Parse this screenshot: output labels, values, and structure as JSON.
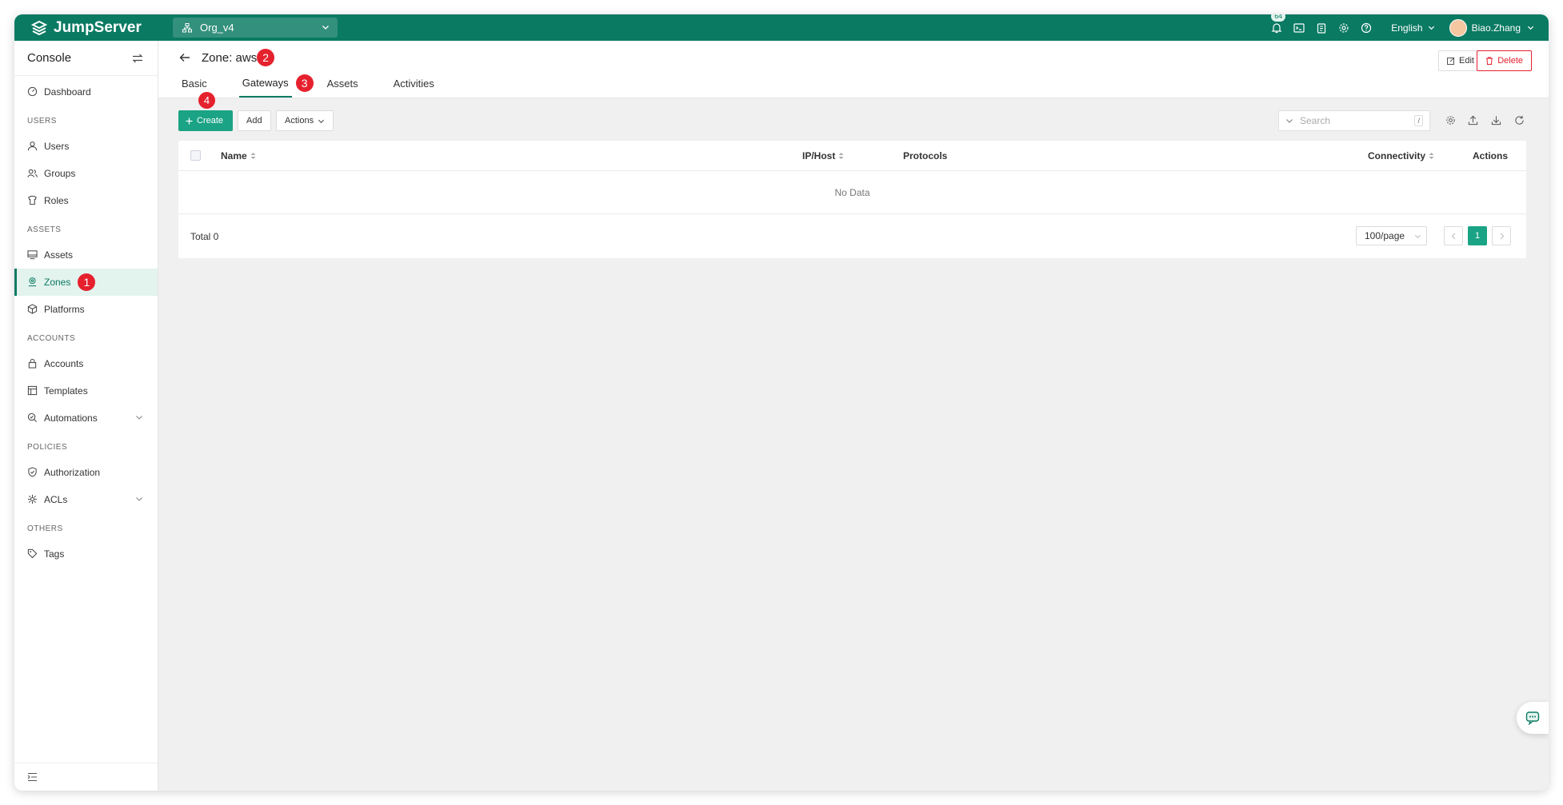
{
  "app": {
    "logo_text": "JumpServer"
  },
  "topbar": {
    "org": "Org_v4",
    "notification_count": "64",
    "language": "English",
    "username": "Biao.Zhang"
  },
  "sidebar": {
    "header": "Console",
    "sections": [
      {
        "items": [
          {
            "label": "Dashboard",
            "icon": "dashboard-icon"
          }
        ]
      },
      {
        "title": "USERS",
        "items": [
          {
            "label": "Users",
            "icon": "user-icon"
          },
          {
            "label": "Groups",
            "icon": "group-icon"
          },
          {
            "label": "Roles",
            "icon": "role-icon"
          }
        ]
      },
      {
        "title": "ASSETS",
        "items": [
          {
            "label": "Assets",
            "icon": "monitor-icon"
          },
          {
            "label": "Zones",
            "icon": "zone-icon",
            "active": true,
            "marker": "1"
          },
          {
            "label": "Platforms",
            "icon": "cube-icon"
          }
        ]
      },
      {
        "title": "ACCOUNTS",
        "items": [
          {
            "label": "Accounts",
            "icon": "lock-icon"
          },
          {
            "label": "Templates",
            "icon": "template-icon"
          },
          {
            "label": "Automations",
            "icon": "automation-icon",
            "expandable": true
          }
        ]
      },
      {
        "title": "POLICIES",
        "items": [
          {
            "label": "Authorization",
            "icon": "shield-icon"
          },
          {
            "label": "ACLs",
            "icon": "acl-icon",
            "expandable": true
          }
        ]
      },
      {
        "title": "OTHERS",
        "items": [
          {
            "label": "Tags",
            "icon": "tag-icon"
          }
        ]
      }
    ]
  },
  "page": {
    "title": "Zone: aws",
    "title_marker": "2",
    "edit_label": "Edit",
    "delete_label": "Delete",
    "tabs": [
      {
        "label": "Basic"
      },
      {
        "label": "Gateways",
        "active": true,
        "marker": "3"
      },
      {
        "label": "Assets"
      },
      {
        "label": "Activities"
      }
    ]
  },
  "toolbar": {
    "create_label": "Create",
    "create_marker": "4",
    "add_label": "Add",
    "actions_label": "Actions",
    "search_placeholder": "Search",
    "search_shortcut": "/"
  },
  "table": {
    "columns": [
      "Name",
      "IP/Host",
      "Protocols",
      "Connectivity",
      "Actions"
    ],
    "empty_text": "No Data",
    "total_text": "Total 0",
    "page_size": "100/page",
    "current_page": "1"
  },
  "colors": {
    "brand": "#0a7a63",
    "primary_button": "#1aa384",
    "marker": "#e5212e",
    "delete": "#e5212e"
  }
}
